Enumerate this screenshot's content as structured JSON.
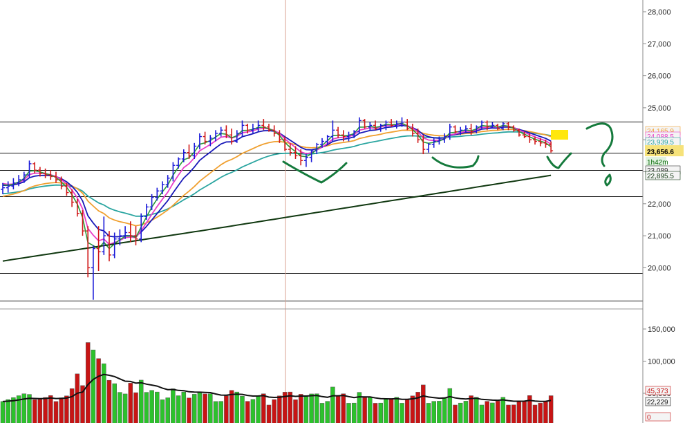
{
  "colors": {
    "up_bar": "#1a1ad8",
    "down_bar": "#d01818",
    "vol_up": "#2cc22c",
    "vol_down": "#c81414",
    "ema_magenta": "#e83ec8",
    "ema_green": "#2a9a3a",
    "ema_blue": "#1818b8",
    "ema_orange": "#f0a030",
    "ema_teal": "#2aa5a0",
    "sma_dark": "#103810",
    "vol_avg": "#111111",
    "annotation": "#157a3c",
    "highlight": "#ffe600",
    "crosshair": "#d8a090",
    "price_badge_bg": "#f6e27a"
  },
  "chart_data": [
    {
      "type": "line",
      "title": "",
      "y_axis_ticks": [
        "28,000",
        "27,000",
        "26,000",
        "25,000",
        "24,000",
        "23,000",
        "22,000",
        "21,000",
        "20,000"
      ],
      "ylim": [
        19000,
        28400
      ],
      "x_count": 105,
      "ohlc_bars": [
        [
          22450,
          22650,
          22300,
          22500
        ],
        [
          22500,
          22700,
          22350,
          22550
        ],
        [
          22550,
          22800,
          22450,
          22650
        ],
        [
          22650,
          22900,
          22550,
          22750
        ],
        [
          22750,
          23000,
          22650,
          22900
        ],
        [
          22900,
          23350,
          22800,
          23250
        ],
        [
          23250,
          23300,
          22950,
          23050
        ],
        [
          23050,
          23150,
          22850,
          22950
        ],
        [
          22950,
          23100,
          22800,
          22900
        ],
        [
          22900,
          23050,
          22750,
          22850
        ],
        [
          22850,
          23000,
          22650,
          22750
        ],
        [
          22750,
          22850,
          22450,
          22550
        ],
        [
          22550,
          22650,
          22250,
          22350
        ],
        [
          22350,
          22450,
          21900,
          22050
        ],
        [
          22050,
          22150,
          21600,
          21700
        ],
        [
          21700,
          21800,
          21000,
          21150
        ],
        [
          21150,
          21300,
          19700,
          20000
        ],
        [
          20000,
          20700,
          19000,
          20600
        ],
        [
          20600,
          21300,
          19900,
          20500
        ],
        [
          20500,
          21600,
          20400,
          21000
        ],
        [
          21000,
          21150,
          20200,
          20400
        ],
        [
          20400,
          21100,
          20300,
          20900
        ],
        [
          20900,
          21200,
          20700,
          21000
        ],
        [
          21000,
          21300,
          20900,
          21100
        ],
        [
          21100,
          21450,
          20800,
          21000
        ],
        [
          21000,
          21300,
          20700,
          20900
        ],
        [
          20900,
          21700,
          20800,
          21600
        ],
        [
          21600,
          22000,
          21500,
          21900
        ],
        [
          21900,
          22300,
          21800,
          22200
        ],
        [
          22200,
          22500,
          22100,
          22400
        ],
        [
          22400,
          22700,
          22300,
          22600
        ],
        [
          22600,
          22900,
          22500,
          22800
        ],
        [
          22800,
          23300,
          22700,
          23200
        ],
        [
          23200,
          23450,
          23100,
          23400
        ],
        [
          23400,
          23700,
          23300,
          23600
        ],
        [
          23600,
          23850,
          23400,
          23500
        ],
        [
          23500,
          23900,
          23400,
          23800
        ],
        [
          23800,
          24200,
          23700,
          24100
        ],
        [
          24100,
          24250,
          23850,
          23950
        ],
        [
          23950,
          24150,
          23800,
          24050
        ],
        [
          24050,
          24300,
          23950,
          24200
        ],
        [
          24200,
          24400,
          24100,
          24300
        ],
        [
          24300,
          24450,
          24050,
          24150
        ],
        [
          24150,
          24350,
          23850,
          23950
        ],
        [
          23950,
          24300,
          23900,
          24200
        ],
        [
          24200,
          24600,
          24100,
          24450
        ],
        [
          24450,
          24500,
          24200,
          24300
        ],
        [
          24300,
          24500,
          24200,
          24350
        ],
        [
          24350,
          24600,
          24250,
          24450
        ],
        [
          24450,
          24650,
          24300,
          24400
        ],
        [
          24400,
          24500,
          24250,
          24300
        ],
        [
          24300,
          24450,
          24100,
          24200
        ],
        [
          24200,
          24300,
          23900,
          24000
        ],
        [
          24000,
          24100,
          23650,
          23700
        ],
        [
          23700,
          23900,
          23500,
          23600
        ],
        [
          23600,
          23800,
          23400,
          23500
        ],
        [
          23500,
          23700,
          23200,
          23350
        ],
        [
          23350,
          23550,
          23150,
          23450
        ],
        [
          23450,
          23700,
          23300,
          23650
        ],
        [
          23650,
          23900,
          23550,
          23850
        ],
        [
          23850,
          24050,
          23750,
          23950
        ],
        [
          23950,
          24150,
          23850,
          24100
        ],
        [
          24100,
          24600,
          23950,
          24300
        ],
        [
          24300,
          24400,
          24050,
          24150
        ],
        [
          24150,
          24300,
          23950,
          24100
        ],
        [
          24100,
          24250,
          23950,
          24150
        ],
        [
          24150,
          24300,
          24050,
          24250
        ],
        [
          24250,
          24700,
          24200,
          24600
        ],
        [
          24600,
          24650,
          24350,
          24400
        ],
        [
          24400,
          24550,
          24300,
          24450
        ],
        [
          24450,
          24600,
          24300,
          24350
        ],
        [
          24350,
          24500,
          24250,
          24450
        ],
        [
          24450,
          24600,
          24300,
          24550
        ],
        [
          24550,
          24650,
          24400,
          24450
        ],
        [
          24450,
          24600,
          24350,
          24500
        ],
        [
          24500,
          24700,
          24400,
          24550
        ],
        [
          24550,
          24650,
          24300,
          24350
        ],
        [
          24350,
          24500,
          24100,
          24200
        ],
        [
          24200,
          24350,
          23900,
          24000
        ],
        [
          24000,
          24150,
          23550,
          23700
        ],
        [
          23700,
          23900,
          23600,
          23850
        ],
        [
          23850,
          24050,
          23750,
          23950
        ],
        [
          23950,
          24100,
          23850,
          24000
        ],
        [
          24000,
          24200,
          23900,
          24100
        ],
        [
          24100,
          24500,
          24000,
          24400
        ],
        [
          24400,
          24450,
          24200,
          24250
        ],
        [
          24250,
          24400,
          24150,
          24300
        ],
        [
          24300,
          24450,
          24200,
          24350
        ],
        [
          24350,
          24500,
          24150,
          24250
        ],
        [
          24250,
          24450,
          24200,
          24400
        ],
        [
          24400,
          24600,
          24350,
          24550
        ],
        [
          24550,
          24600,
          24300,
          24400
        ],
        [
          24400,
          24550,
          24350,
          24450
        ],
        [
          24450,
          24500,
          24300,
          24350
        ],
        [
          24350,
          24550,
          24300,
          24500
        ],
        [
          24500,
          24550,
          24300,
          24400
        ],
        [
          24400,
          24450,
          24250,
          24300
        ],
        [
          24300,
          24350,
          24100,
          24150
        ],
        [
          24150,
          24250,
          24050,
          24100
        ],
        [
          24100,
          24200,
          23900,
          24000
        ],
        [
          24000,
          24100,
          23850,
          23950
        ],
        [
          23950,
          24050,
          23800,
          23900
        ],
        [
          23900,
          24000,
          23750,
          23850
        ],
        [
          23850,
          23950,
          23600,
          23656.6
        ]
      ],
      "price_badges": [
        {
          "text": "24,165.9",
          "value": 24165.9,
          "color": "#f0a030"
        },
        {
          "text": "24,088.5",
          "value": 24088.5,
          "color": "#e83ec8"
        },
        {
          "text": "23,939.5",
          "value": 23939.5,
          "color": "#2aa5a0"
        },
        {
          "text": "23,656.6",
          "value": 23656.6,
          "color": "#000000"
        },
        {
          "text": "1h42m",
          "value": 23380,
          "color": "#0a6a0a"
        },
        {
          "text": "23,089",
          "value": 23089,
          "color": "#333333"
        },
        {
          "text": "22,895.5",
          "value": 22895.5,
          "color": "#103810"
        }
      ],
      "horizontal_levels": [
        24560,
        23600,
        23060,
        22230,
        19830,
        18980
      ]
    },
    {
      "type": "bar",
      "title": "",
      "y_axis_ticks": [
        "150,000",
        "100,000",
        "50,000"
      ],
      "ylim": [
        0,
        182000
      ],
      "badges": [
        "45,373",
        "22,229",
        "0"
      ]
    }
  ]
}
